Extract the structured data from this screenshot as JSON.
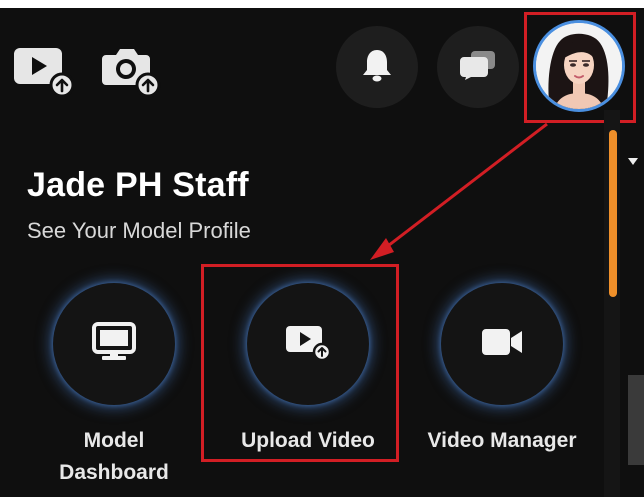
{
  "header": {
    "icons": [
      "upload-video-icon",
      "upload-photo-icon",
      "bell-icon",
      "chat-icon",
      "avatar"
    ]
  },
  "profile": {
    "name": "Jade PH Staff",
    "link_label": "See Your Model Profile"
  },
  "actions": [
    {
      "id": "model-dashboard",
      "line1": "Model",
      "line2": "Dashboard",
      "icon": "monitor-icon"
    },
    {
      "id": "upload-video",
      "line1": "Upload Video",
      "line2": "",
      "icon": "upload-video-icon"
    },
    {
      "id": "video-manager",
      "line1": "Video Manager",
      "line2": "",
      "icon": "video-camera-icon"
    }
  ],
  "colors": {
    "background": "#0f0f0f",
    "highlight": "#d21e24",
    "avatar_ring": "#4a8fe0",
    "scroll_thumb": "#f0902a",
    "glow": "#4a80cc"
  }
}
